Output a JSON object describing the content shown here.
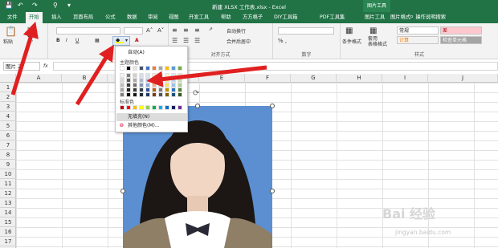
{
  "app": {
    "window_title": "新建 XLSX 工作表.xlsx  -  Excel",
    "picture_tools_label": "图片工具"
  },
  "tabs": [
    "文件",
    "开始",
    "插入",
    "页面布局",
    "公式",
    "数据",
    "审阅",
    "视图",
    "开发工具",
    "帮助",
    "方方格子",
    "DIY工具箱",
    "PDF工具集",
    "图片工具",
    "图片格式"
  ],
  "tell_me": "操作说明搜索",
  "ribbon": {
    "paste_label": "粘贴",
    "wrap_text": "自动换行",
    "merge_center": "合并后居中",
    "alignment_group": "对齐方式",
    "number_group": "数字",
    "cond_format": "条件格式",
    "table_format": "套用\n表格格式",
    "styles_group": "样式",
    "style_normal": "常规",
    "style_bad": "差",
    "style_calc": "计算",
    "style_check": "检查单元格"
  },
  "formula_bar": {
    "name_box": "图片 2",
    "fx": "fx"
  },
  "columns": [
    "A",
    "B",
    "C",
    "D",
    "E",
    "F",
    "G",
    "H",
    "I",
    "J"
  ],
  "rows": [
    "1",
    "2",
    "3",
    "4",
    "5",
    "6",
    "7",
    "8",
    "9",
    "10",
    "11",
    "12",
    "13",
    "14",
    "15",
    "16",
    "17"
  ],
  "fill_dropdown": {
    "auto_label": "自动(A)",
    "theme_colors_label": "主题颜色",
    "standard_colors_label": "标准色",
    "no_fill": "无填充(N)",
    "more_colors": "其他颜色(M)...",
    "theme_top": [
      "#ffffff",
      "#000000",
      "#e7e6e6",
      "#44546a",
      "#4472c4",
      "#ed7d31",
      "#a5a5a5",
      "#ffc000",
      "#5b9bd5",
      "#70ad47"
    ],
    "theme_grid": [
      [
        "#f2f2f2",
        "#7f7f7f",
        "#d0cece",
        "#d6dce4",
        "#d9e2f3",
        "#fbe5d5",
        "#ededed",
        "#fff2cc",
        "#deebf6",
        "#e2efd9"
      ],
      [
        "#d8d8d8",
        "#595959",
        "#aeabab",
        "#adb9ca",
        "#b4c6e7",
        "#f7cbac",
        "#dbdbdb",
        "#fee599",
        "#bdd7ee",
        "#c5e0b3"
      ],
      [
        "#bfbfbf",
        "#3f3f3f",
        "#757070",
        "#8496b0",
        "#8eaadb",
        "#f4b183",
        "#c9c9c9",
        "#ffd965",
        "#9cc3e5",
        "#a8d08d"
      ],
      [
        "#a5a5a5",
        "#262626",
        "#3a3838",
        "#323f4f",
        "#2f5496",
        "#c55a11",
        "#7b7b7b",
        "#bf9000",
        "#2e75b5",
        "#538135"
      ],
      [
        "#7f7f7f",
        "#0c0c0c",
        "#171616",
        "#222a35",
        "#1f3864",
        "#833c0b",
        "#525252",
        "#7f6000",
        "#1e4e79",
        "#375623"
      ]
    ],
    "standard": [
      "#c00000",
      "#ff0000",
      "#ffc000",
      "#ffff00",
      "#92d050",
      "#00b050",
      "#00b0f0",
      "#0070c0",
      "#002060",
      "#7030a0"
    ]
  },
  "watermark": {
    "text": "Bai 经验",
    "url": "jingyan.baidu.com"
  },
  "colors": {
    "excel_green": "#217346",
    "photo_bg": "#5b8fd1",
    "arrow_red": "#e02020"
  }
}
